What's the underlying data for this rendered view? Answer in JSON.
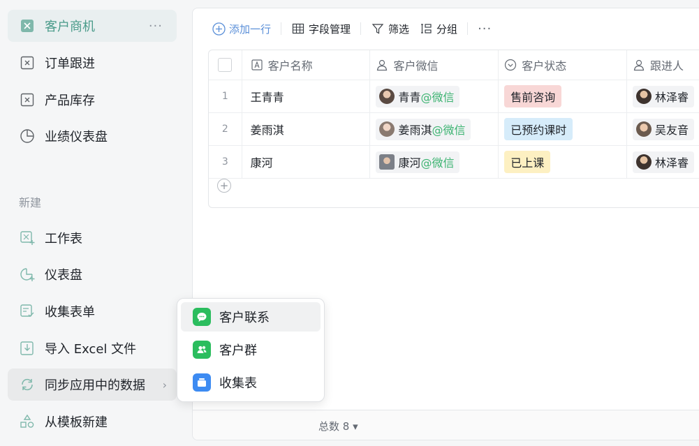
{
  "sidebar": {
    "items": [
      {
        "label": "客户商机",
        "icon": "sheet-icon",
        "more": "···"
      },
      {
        "label": "订单跟进",
        "icon": "sheet-icon"
      },
      {
        "label": "产品库存",
        "icon": "sheet-icon"
      },
      {
        "label": "业绩仪表盘",
        "icon": "pie-chart-icon"
      }
    ],
    "section_label": "新建",
    "create_items": [
      {
        "label": "工作表",
        "icon": "new-sheet-icon"
      },
      {
        "label": "仪表盘",
        "icon": "new-dashboard-icon"
      },
      {
        "label": "收集表单",
        "icon": "new-form-icon"
      },
      {
        "label": "导入 Excel 文件",
        "icon": "import-icon"
      },
      {
        "label": "同步应用中的数据",
        "icon": "sync-icon",
        "chevron": "›"
      },
      {
        "label": "从模板新建",
        "icon": "template-icon"
      }
    ]
  },
  "toolbar": {
    "add_row": "添加一行",
    "field_manage": "字段管理",
    "filter": "筛选",
    "group": "分组",
    "more": "···"
  },
  "table": {
    "columns": [
      "客户名称",
      "客户微信",
      "客户状态",
      "跟进人"
    ],
    "rows": [
      {
        "index": "1",
        "name": "王青青",
        "wechat_name": "青青",
        "wechat_suffix": "@微信",
        "status": "售前咨询",
        "owner": "林泽睿"
      },
      {
        "index": "2",
        "name": "姜雨淇",
        "wechat_name": "姜雨淇",
        "wechat_suffix": "@微信",
        "status": "已预约课时",
        "owner": "吴友音"
      },
      {
        "index": "3",
        "name": "康河",
        "wechat_name": "康河",
        "wechat_suffix": "@微信",
        "status": "已上课",
        "owner": "林泽睿"
      }
    ],
    "add_symbol": "+"
  },
  "footer": {
    "total": "总数 8 ▾"
  },
  "popup": {
    "items": [
      {
        "label": "客户联系",
        "icon": "wechat-contact-icon"
      },
      {
        "label": "客户群",
        "icon": "customer-group-icon"
      },
      {
        "label": "收集表",
        "icon": "collect-form-icon"
      }
    ]
  },
  "colors": {
    "accent": "#4a9b8a",
    "link_blue": "#5a8fd8",
    "wechat_green": "#3cb371",
    "status_presale_bg": "#f8d7d6",
    "status_booked_bg": "#d6ecfa",
    "status_attended_bg": "#fdf0c2"
  }
}
